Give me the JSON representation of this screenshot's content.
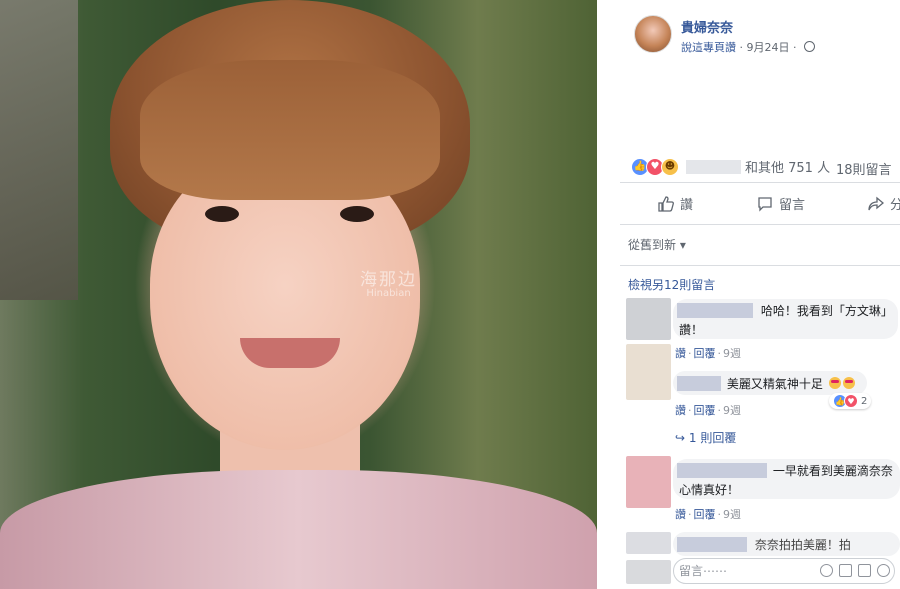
{
  "photo": {
    "watermark_cn": "海那边",
    "watermark_en": "Hinabian"
  },
  "post": {
    "page_name": "貴婦奈奈",
    "mentioned_page": "說這專頁讚",
    "date": "9月24日",
    "privacy_icon": "globe-icon"
  },
  "reactions": {
    "types": [
      "like",
      "love",
      "haha"
    ],
    "text": "和其他 751 人",
    "comments_count": "18則留言"
  },
  "actions": {
    "like": "讚",
    "comment": "留言",
    "share": "分享"
  },
  "comments_section": {
    "sort_label": "從舊到新",
    "view_more": "檢視另12則留言",
    "reply_count": "1 則回覆",
    "input_placeholder": "留言⋯⋯"
  },
  "comments": [
    {
      "text_line1": "哈哈！我看到「方文琳」",
      "text_line2": "讚！",
      "like": "讚",
      "reply": "回覆",
      "time": "9週"
    },
    {
      "text": "美麗又精氣神十足",
      "like": "讚",
      "reply": "回覆",
      "time": "9週",
      "reaction_count": "2"
    },
    {
      "text_line1": "一早就看到美麗滴奈奈",
      "text_line2": "心情真好！",
      "like": "讚",
      "reply": "回覆",
      "time": "9週"
    },
    {
      "text": "奈奈拍拍美麗！拍"
    }
  ],
  "colors": {
    "link": "#365899",
    "secondary_text": "#606770",
    "bubble": "#f2f3f5",
    "like_blue": "#5890ff",
    "love_red": "#f25268"
  }
}
